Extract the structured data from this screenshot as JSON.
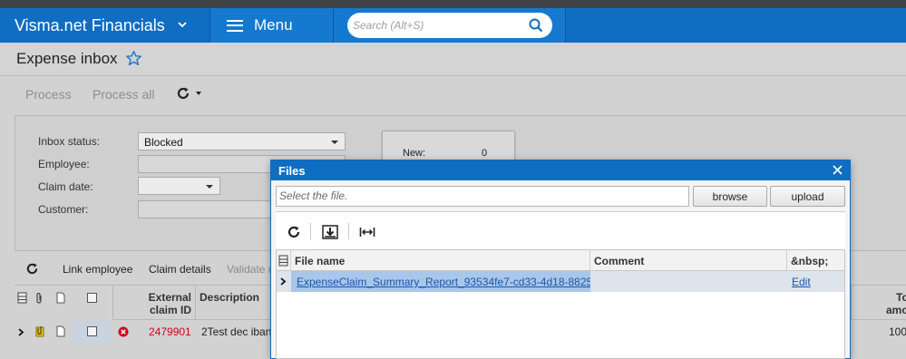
{
  "app": {
    "name": "Visma.net Financials",
    "menu_label": "Menu",
    "search_placeholder": "Search (Alt+S)"
  },
  "page": {
    "title": "Expense inbox"
  },
  "toolbar": {
    "process": "Process",
    "process_all": "Process all"
  },
  "form": {
    "inbox_status_label": "Inbox status:",
    "inbox_status_value": "Blocked",
    "employee_label": "Employee:",
    "claim_date_label": "Claim date:",
    "customer_label": "Customer:",
    "new_label": "New:",
    "new_value": "0"
  },
  "grid_toolbar": {
    "link_employee": "Link employee",
    "claim_details": "Claim details",
    "validate": "Validate m"
  },
  "grid": {
    "headers": {
      "external_claim_id_1": "External",
      "external_claim_id_2": "claim ID",
      "description": "Description",
      "total_1": "To",
      "total_2": "amo"
    },
    "row": {
      "claim_id": "2479901",
      "description": "2Test dec iban",
      "amount": "100."
    }
  },
  "files_dialog": {
    "title": "Files",
    "file_placeholder": "Select the file.",
    "browse": "browse",
    "upload": "upload",
    "columns": {
      "file_name": "File name",
      "comment": "Comment",
      "extra": "&nbsp;"
    },
    "row": {
      "file_name": "ExpenseClaim_Summary_Report_93534fe7-cd33-4d18-8825-...",
      "comment": "",
      "action": "Edit"
    }
  },
  "colors": {
    "brand_blue": "#0f6dc2",
    "error_red": "#d0021b",
    "link": "#1a56a6"
  }
}
